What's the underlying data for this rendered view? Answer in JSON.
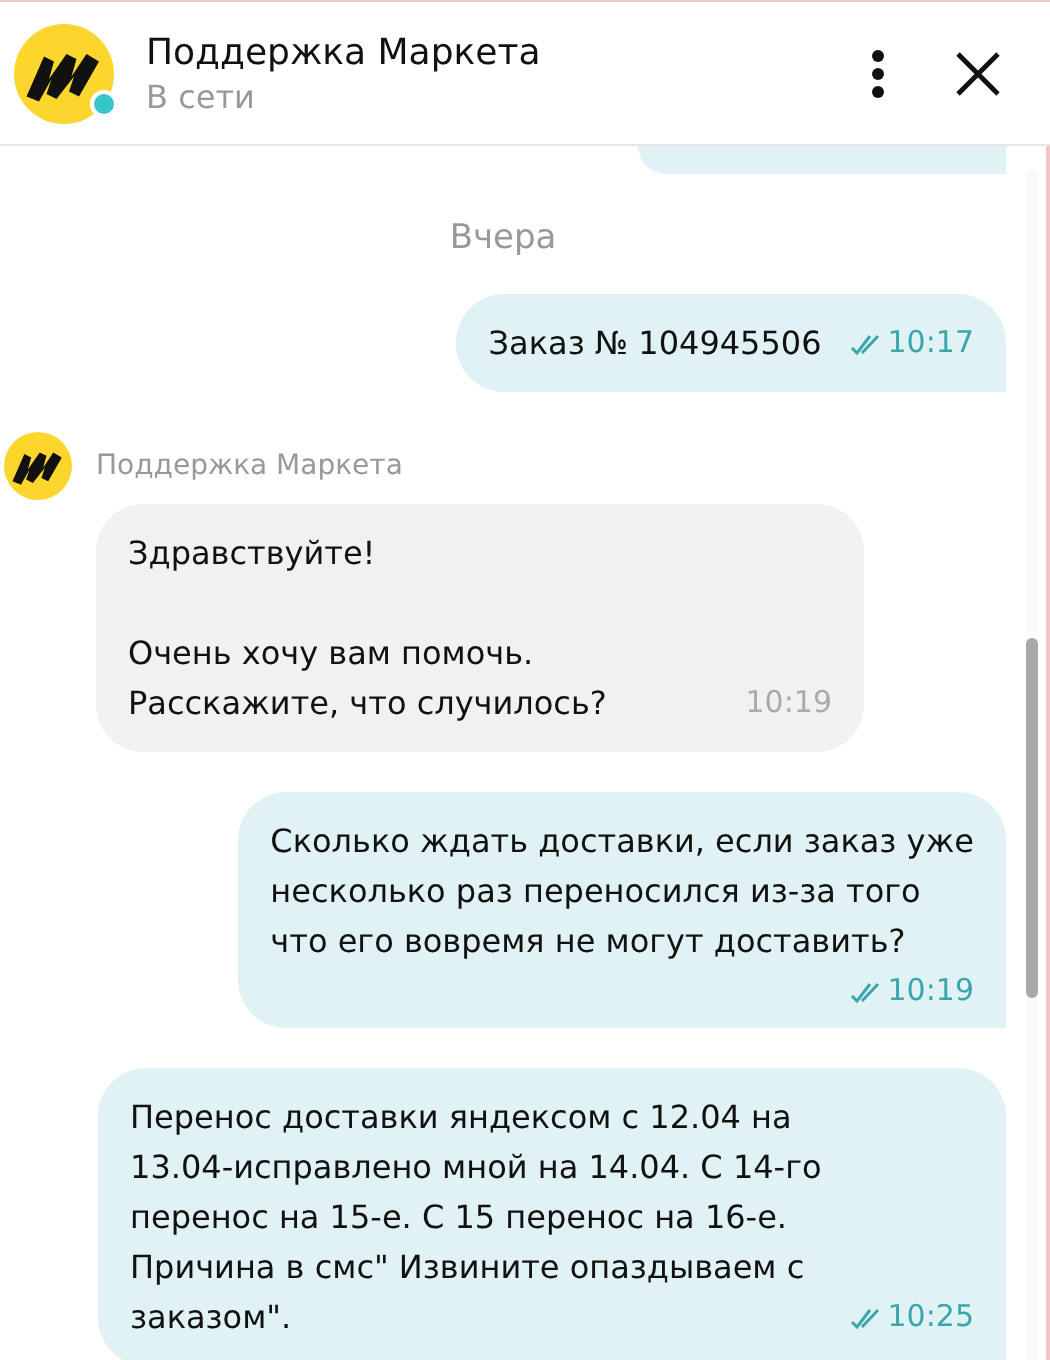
{
  "header": {
    "title": "Поддержка Маркета",
    "status": "В сети",
    "online": true
  },
  "date_divider": "Вчера",
  "messages": [
    {
      "kind": "outgoing",
      "partial": true
    },
    {
      "kind": "outgoing",
      "text": "Заказ № 104945506",
      "time": "10:17",
      "read": true
    },
    {
      "kind": "incoming",
      "sender": "Поддержка Маркета",
      "text": "Здравствуйте!\n\nОчень хочу вам помочь.\nРасскажите, что случилось?",
      "time": "10:19"
    },
    {
      "kind": "outgoing",
      "text": "Сколько ждать доставки, если заказ уже\nнесколько раз переносился из-за того\nчто его вовремя не могут доставить?",
      "time": "10:19",
      "read": true,
      "time_below": true
    },
    {
      "kind": "outgoing",
      "text": "Перенос доставки яндексом с 12.04 на\n13.04-исправлено мной на 14.04. С 14-го\nперенос на 15-е. С 15 перенос на 16-е.\nПричина в смс\" Извините опаздываем с\nзаказом\".",
      "time": "10:25",
      "read": true
    }
  ]
}
